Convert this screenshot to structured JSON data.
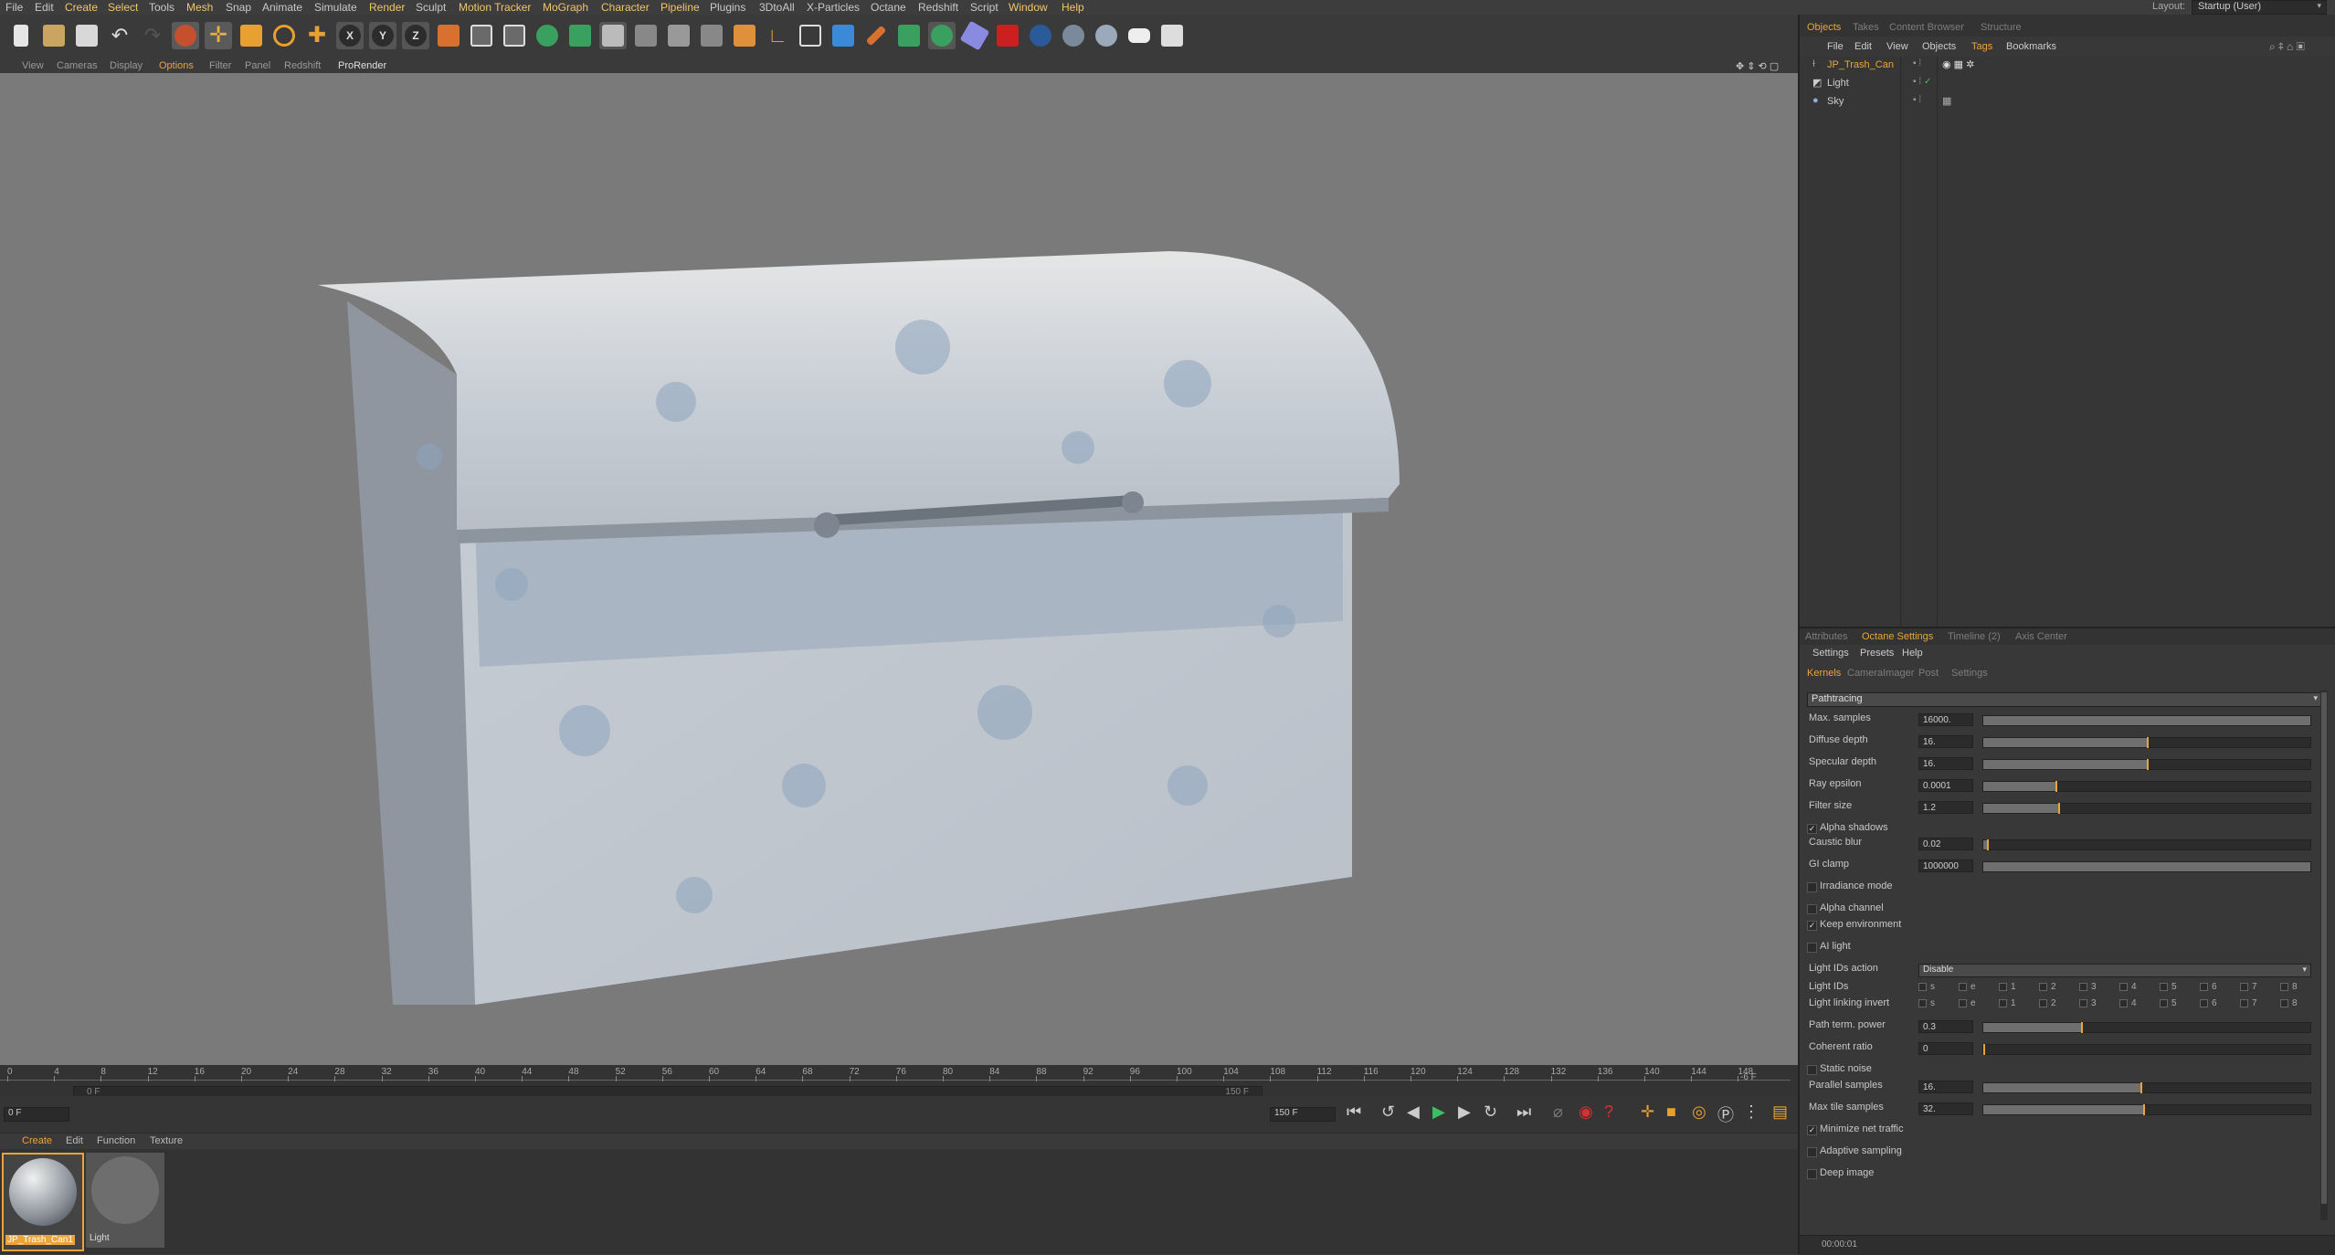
{
  "menu": [
    "File",
    "Edit",
    "Create",
    "Select",
    "Tools",
    "Mesh",
    "Snap",
    "Animate",
    "Simulate",
    "Render",
    "Sculpt",
    "Motion Tracker",
    "MoGraph",
    "Character",
    "Pipeline",
    "Plugins",
    "3DtoAll",
    "X-Particles",
    "Octane",
    "Redshift",
    "Script",
    "Window",
    "Help"
  ],
  "layout": {
    "label": "Layout:",
    "value": "Startup (User)"
  },
  "viewport_menu": [
    "View",
    "Cameras",
    "Display",
    "Options",
    "Filter",
    "Panel",
    "Redshift",
    "ProRender"
  ],
  "object_manager": {
    "tabs": [
      "Objects",
      "Takes",
      "Content Browser",
      "Structure"
    ],
    "menu": [
      "File",
      "Edit",
      "View",
      "Objects",
      "Tags",
      "Bookmarks"
    ],
    "objects": [
      "JP_Trash_Can",
      "Light",
      "Sky"
    ]
  },
  "attributes": {
    "tabs": [
      "Attributes",
      "Octane Settings",
      "Timeline (2)",
      "Axis Center"
    ],
    "menu": [
      "Settings",
      "Presets",
      "Help"
    ],
    "subtabs": [
      "Kernels",
      "CameraImager",
      "Post",
      "Settings"
    ],
    "kernel": "Pathtracing",
    "params": [
      {
        "label": "Max. samples",
        "value": "16000.",
        "fill": 1.0
      },
      {
        "label": "Diffuse depth",
        "value": "16.",
        "fill": 0.5
      },
      {
        "label": "Specular depth",
        "value": "16.",
        "fill": 0.5
      },
      {
        "label": "Ray epsilon",
        "value": "0.0001",
        "fill": 0.22
      },
      {
        "label": "Filter size",
        "value": "1.2",
        "fill": 0.23
      }
    ],
    "alpha_shadows": "Alpha shadows",
    "caustic_blur": {
      "label": "Caustic blur",
      "value": "0.02",
      "fill": 0.01
    },
    "gi_clamp": {
      "label": "GI clamp",
      "value": "1000000",
      "fill": 1.0
    },
    "irradiance_mode": "Irradiance mode",
    "alpha_channel": "Alpha channel",
    "keep_environment": "Keep environment",
    "ai_light": "AI light",
    "light_ids_action": {
      "label": "Light IDs action",
      "value": "Disable"
    },
    "light_ids": {
      "label": "Light IDs",
      "ids": [
        "s",
        "e",
        "1",
        "2",
        "3",
        "4",
        "5",
        "6",
        "7",
        "8"
      ]
    },
    "light_linking_invert": {
      "label": "Light linking invert",
      "ids": [
        "s",
        "e",
        "1",
        "2",
        "3",
        "4",
        "5",
        "6",
        "7",
        "8"
      ]
    },
    "path_term_power": {
      "label": "Path term. power",
      "value": "0.3",
      "fill": 0.3
    },
    "coherent_ratio": {
      "label": "Coherent ratio",
      "value": "0",
      "fill": 0.0
    },
    "static_noise": "Static noise",
    "parallel_samples": {
      "label": "Parallel samples",
      "value": "16.",
      "fill": 0.48
    },
    "max_tile_samples": {
      "label": "Max tile samples",
      "value": "32.",
      "fill": 0.49
    },
    "minimize_net_traffic": "Minimize net traffic",
    "adaptive_sampling": "Adaptive sampling",
    "deep_image": "Deep image",
    "status_time": "00:00:01"
  },
  "timeline": {
    "ticks": [
      "0",
      "4",
      "8",
      "12",
      "16",
      "20",
      "24",
      "28",
      "32",
      "36",
      "40",
      "44",
      "48",
      "52",
      "56",
      "60",
      "64",
      "68",
      "72",
      "76",
      "80",
      "84",
      "88",
      "92",
      "96",
      "100",
      "104",
      "108",
      "112",
      "116",
      "120",
      "124",
      "128",
      "132",
      "136",
      "140",
      "144",
      "148"
    ],
    "end_label": "-6 F",
    "current_frame": "0 F",
    "start_field": "0 F",
    "end_field": "150 F",
    "max_field": "150 F"
  },
  "material_manager": {
    "menu": [
      "Create",
      "Edit",
      "Function",
      "Texture"
    ],
    "materials": [
      "JP_Trash_Can1",
      "Light"
    ]
  },
  "colors": {
    "accent": "#e9a53a",
    "viewport": "#7a7a7a",
    "panel": "#383838"
  }
}
